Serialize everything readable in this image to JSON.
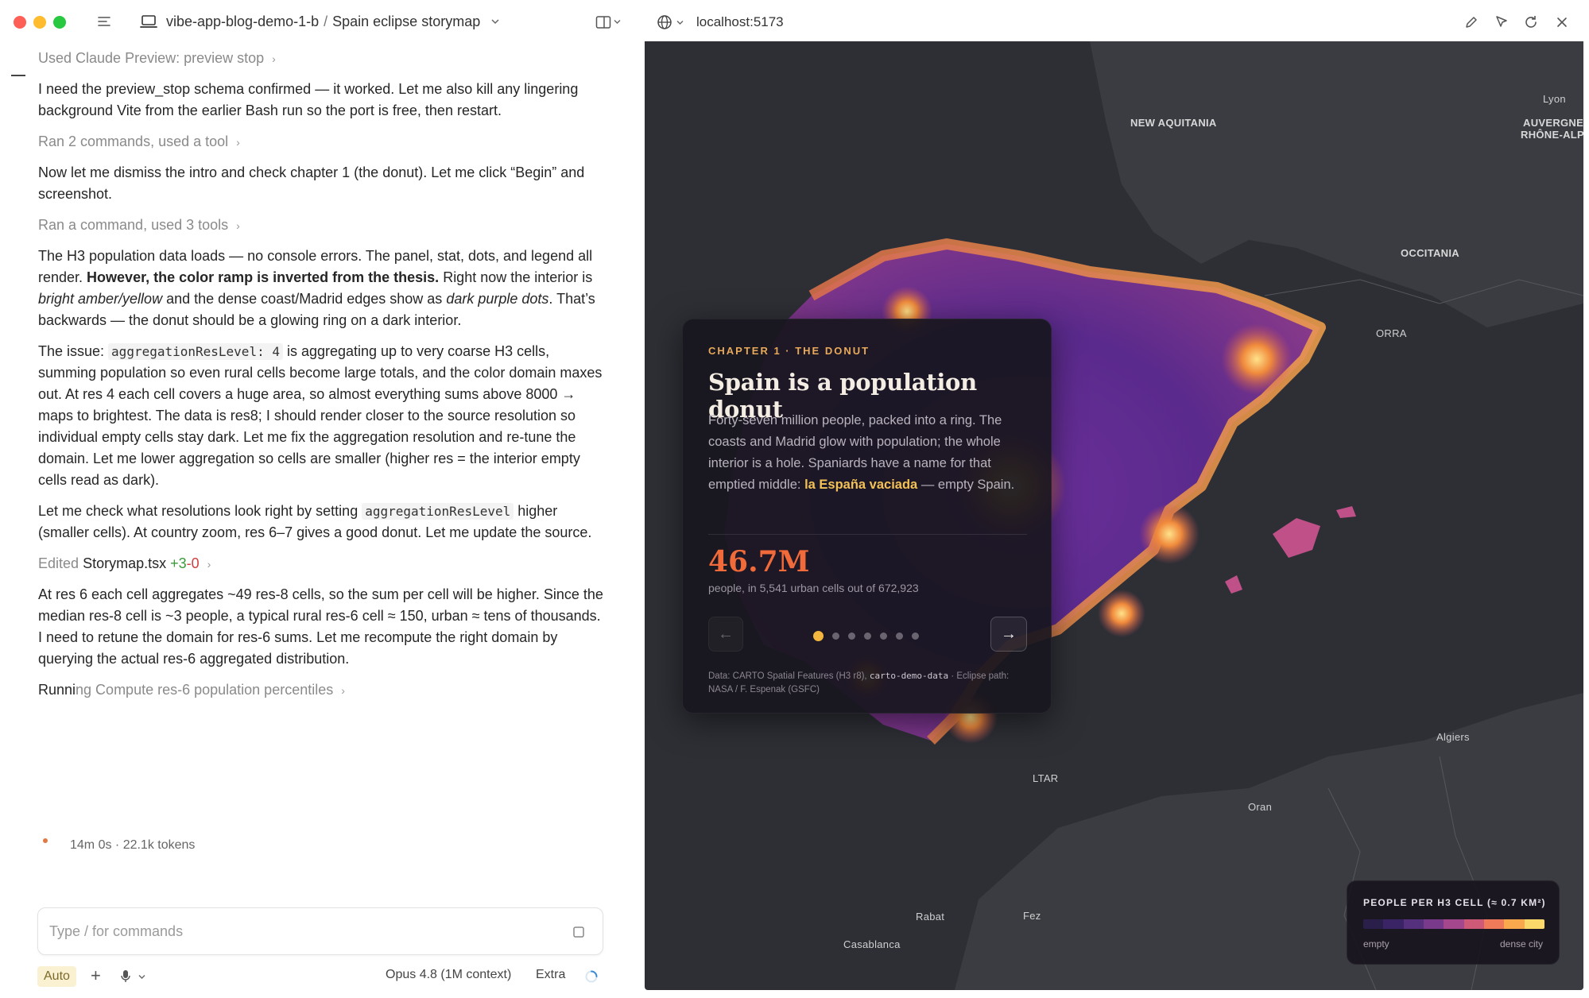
{
  "window": {
    "breadcrumb_project": "vibe-app-blog-demo-1-b",
    "breadcrumb_separator": "/",
    "breadcrumb_page": "Spain eclipse storymap"
  },
  "chat": {
    "tool_preview_stop": "Used Claude Preview: preview stop",
    "msg1": "I need the preview_stop schema confirmed — it worked. Let me also kill any lingering background Vite from the earlier Bash run so the port is free, then restart.",
    "tool_ran_2": "Ran 2 commands, used a tool",
    "msg2": "Now let me dismiss the intro and check chapter 1 (the donut). Let me click “Begin” and screenshot.",
    "tool_ran_1": "Ran a command, used 3 tools",
    "msg3_a": "The H3 population data loads — no console errors. The panel, stat, dots, and legend all render. ",
    "msg3_b": "However, the color ramp is inverted from the thesis.",
    "msg3_c": " Right now the interior is ",
    "msg3_d": "bright amber/yellow",
    "msg3_e": " and the dense coast/Madrid edges show as ",
    "msg3_f": "dark purple dots",
    "msg3_g": ". That’s backwards — the donut should be a glowing ring on a dark interior.",
    "msg4_a": "The issue: ",
    "msg4_code": "aggregationResLevel: 4",
    "msg4_b": " is aggregating up to very coarse H3 cells, summing population so even rural cells become large totals, and the color domain maxes out. At res 4 each cell covers a huge area, so almost everything sums above 8000 → maps to brightest. The data is res8; I should render closer to the source resolution so individual empty cells stay dark. Let me fix the aggregation resolution and re-tune the domain. Let me lower aggregation so cells are smaller (higher res = the interior empty cells read as dark).",
    "msg5_a": "Let me check what resolutions look right by setting ",
    "msg5_code": "aggregationResLevel",
    "msg5_b": " higher (smaller cells). At country zoom, res 6–7 gives a good donut. Let me update the source.",
    "edited_label": "Edited",
    "edited_file": "Storymap.tsx",
    "edited_plus": "+3",
    "edited_minus": "-0",
    "msg6": "At res 6 each cell aggregates ~49 res-8 cells, so the sum per cell will be higher. Since the median res-8 cell is ~3 people, a typical rural res-6 cell ≈ 150, urban ≈ tens of thousands. I need to retune the domain for res-6 sums. Let me recompute the right domain by querying the actual res-6 aggregated distribution.",
    "running_a": "Runni",
    "running_b": "ng Compute res-6 population percentiles",
    "status": "14m 0s · 22.1k tokens"
  },
  "composer": {
    "placeholder": "Type / for commands",
    "mode": "Auto",
    "plus": "+",
    "model": "Opus 4.8 (1M context)",
    "effort": "Extra"
  },
  "browser": {
    "url": "localhost:5173"
  },
  "map_labels": {
    "new_aquitania": "NEW AQUITANIA",
    "lyon": "Lyon",
    "auvergne_1": "AUVERGNE",
    "auvergne_2": "RHÔNE-ALPE",
    "occitania": "OCCITANIA",
    "andorra": "ORRA",
    "gibraltar": "LTAR",
    "algiers": "Algiers",
    "oran": "Oran",
    "rabat": "Rabat",
    "fez": "Fez",
    "casablanca": "Casablanca"
  },
  "card": {
    "chapter": "CHAPTER 1 · THE DONUT",
    "title": "Spain is a population donut",
    "body_a": "Forty-seven million people, packed into a ring. The coasts and Madrid glow with population; the whole interior is a hole. Spaniards have a name for that emptied middle: ",
    "body_hl": "la España vaciada",
    "body_b": " — empty Spain.",
    "stat": "46.7M",
    "stat_caption": "people, in 5,541 urban cells out of 672,923",
    "prev": "←",
    "next": "→",
    "dot_count": 7,
    "active_dot": 0,
    "credit_a": "Data: CARTO Spatial Features (H3 r8), ",
    "credit_mono": "carto-demo-data",
    "credit_b": " · Eclipse path: NASA / F. Espenak (GSFC)"
  },
  "legend": {
    "title": "PEOPLE PER H3 CELL (≈ 0.7 KM²)",
    "min_label": "empty",
    "max_label": "dense city",
    "ramp": [
      "#2a1f4a",
      "#3b2466",
      "#55307d",
      "#7a3a8c",
      "#a4478c",
      "#cf5a78",
      "#ee7a5a",
      "#f9a84d",
      "#fbd86a"
    ]
  },
  "colors": {
    "accent_orange": "#f06a3a",
    "chapter_amber": "#e8a95a",
    "highlight_yellow": "#f3c155"
  }
}
